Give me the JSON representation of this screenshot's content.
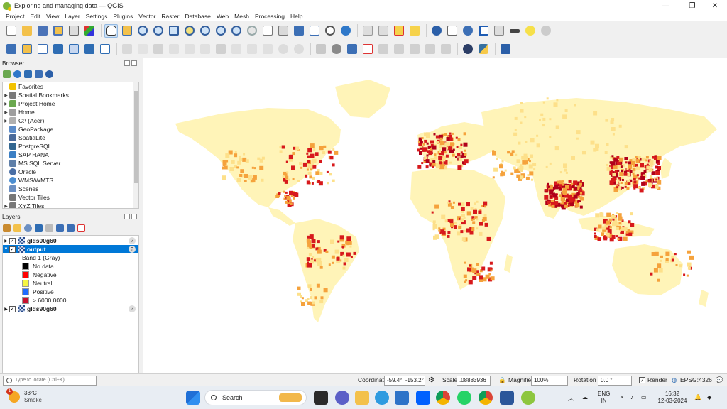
{
  "window": {
    "title": "Exploring and managing data — QGIS",
    "minimize": "—",
    "maximize": "❐",
    "close": "✕"
  },
  "menu": [
    "Project",
    "Edit",
    "View",
    "Layer",
    "Settings",
    "Plugins",
    "Vector",
    "Raster",
    "Database",
    "Web",
    "Mesh",
    "Processing",
    "Help"
  ],
  "browser": {
    "title": "Browser",
    "items": [
      {
        "label": "Favorites",
        "icon": "star-icon",
        "color": "#f2c200",
        "expandable": false
      },
      {
        "label": "Spatial Bookmarks",
        "icon": "bookmark-icon",
        "color": "#7a7a7a",
        "expandable": true
      },
      {
        "label": "Project Home",
        "icon": "folder-icon",
        "color": "#6aa84f",
        "expandable": true
      },
      {
        "label": "Home",
        "icon": "folder-icon",
        "color": "#9e9e9e",
        "expandable": true
      },
      {
        "label": "C:\\ (Acer)",
        "icon": "drive-icon",
        "color": "#b0b0b0",
        "expandable": true
      },
      {
        "label": "GeoPackage",
        "icon": "geopackage-icon",
        "color": "#5b8bc9",
        "expandable": false
      },
      {
        "label": "SpatiaLite",
        "icon": "spatialite-icon",
        "color": "#4a6a9a",
        "expandable": false
      },
      {
        "label": "PostgreSQL",
        "icon": "postgresql-icon",
        "color": "#336791",
        "expandable": false
      },
      {
        "label": "SAP HANA",
        "icon": "saphana-icon",
        "color": "#3b7fc4",
        "expandable": false
      },
      {
        "label": "MS SQL Server",
        "icon": "mssql-icon",
        "color": "#5f7fa8",
        "expandable": false
      },
      {
        "label": "Oracle",
        "icon": "oracle-icon",
        "color": "#4a6fa5",
        "expandable": false
      },
      {
        "label": "WMS/WMTS",
        "icon": "globe-icon",
        "color": "#4c8ed1",
        "expandable": false
      },
      {
        "label": "Scenes",
        "icon": "scenes-icon",
        "color": "#6b8fc2",
        "expandable": false
      },
      {
        "label": "Vector Tiles",
        "icon": "grid-icon",
        "color": "#777777",
        "expandable": false
      },
      {
        "label": "XYZ Tiles",
        "icon": "grid-icon",
        "color": "#777777",
        "expandable": true
      }
    ]
  },
  "layers": {
    "title": "Layers",
    "items": [
      {
        "name": "glds00g60",
        "checked": true,
        "expanded": false,
        "selected": false
      },
      {
        "name": "output",
        "checked": true,
        "expanded": true,
        "selected": true,
        "band": "Band 1 (Gray)",
        "legend": [
          {
            "label": "No data",
            "color": "#000000"
          },
          {
            "label": "Negative",
            "color": "#ff0000"
          },
          {
            "label": "Neutral",
            "color": "#f5f542"
          },
          {
            "label": "Positive",
            "color": "#1e6cff"
          },
          {
            "label": "> 6000.0000",
            "color": "#c8102e"
          }
        ]
      },
      {
        "name": "glds90g60",
        "checked": true,
        "expanded": false,
        "selected": false
      }
    ]
  },
  "map": {
    "colors": {
      "base": "#fff4b8",
      "low": "#fde08a",
      "mid": "#f5a23c",
      "high": "#d7191c",
      "dense": "#b0001a",
      "background": "#ffffff"
    }
  },
  "status": {
    "locate_placeholder": "Type to locate (Ctrl+K)",
    "coordinate_label": "Coordinate",
    "coordinate": "-59.4°, -153.2°",
    "scale_label": "Scale",
    "scale": ".08883936",
    "magnifier_label": "Magnifier",
    "magnifier": "100%",
    "rotation_label": "Rotation",
    "rotation": "0.0 °",
    "render_label": "Render",
    "render_checked": true,
    "crs": "EPSG:4326"
  },
  "taskbar": {
    "weather_temp": "33°C",
    "weather_desc": "Smoke",
    "weather_badge": "1",
    "search_label": "Search",
    "lang": "ENG",
    "region": "IN",
    "time": "16:32",
    "date": "12-03-2024"
  }
}
